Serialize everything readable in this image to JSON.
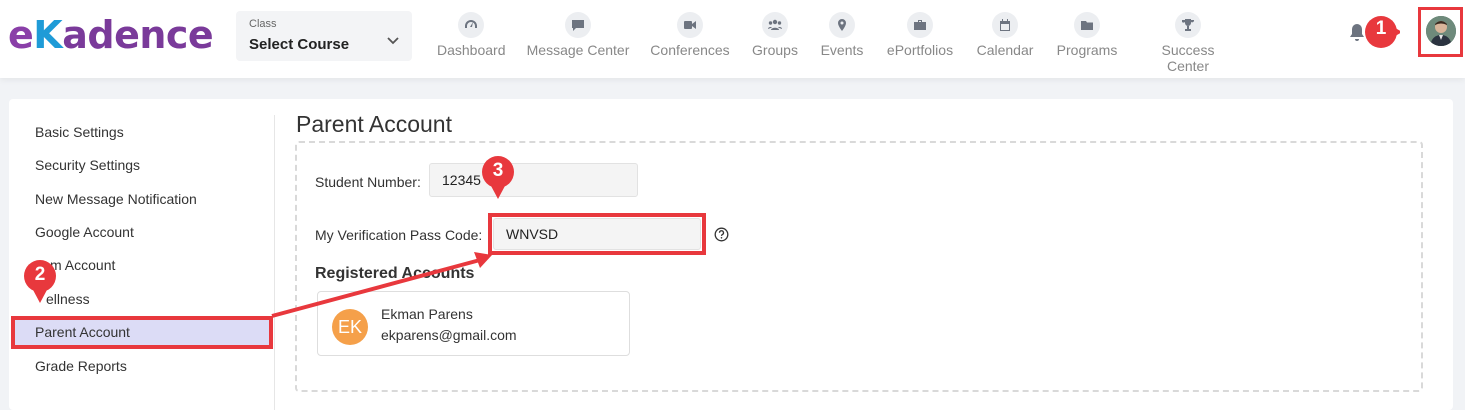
{
  "brand": {
    "e": "e",
    "k": "K",
    "rest": "adence"
  },
  "class_select": {
    "label": "Class",
    "value": "Select Course"
  },
  "nav": [
    {
      "label": "Dashboard",
      "icon": "gauge-icon"
    },
    {
      "label": "Message Center",
      "icon": "chat-icon"
    },
    {
      "label": "Conferences",
      "icon": "video-icon"
    },
    {
      "label": "Groups",
      "icon": "users-icon"
    },
    {
      "label": "Events",
      "icon": "map-pin-icon"
    },
    {
      "label": "ePortfolios",
      "icon": "briefcase-icon"
    },
    {
      "label": "Calendar",
      "icon": "calendar-icon"
    },
    {
      "label": "Programs",
      "icon": "folder-icon"
    },
    {
      "label": "Success Center",
      "icon": "trophy-icon"
    }
  ],
  "markers": [
    "1",
    "2",
    "3"
  ],
  "sidebar": {
    "items": [
      {
        "label": "Basic Settings"
      },
      {
        "label": "Security Settings"
      },
      {
        "label": "New Message Notification"
      },
      {
        "label": "Google Account"
      },
      {
        "label": "m Account"
      },
      {
        "label": "ellness"
      },
      {
        "label": "Parent Account",
        "active": true
      },
      {
        "label": "Grade Reports"
      }
    ]
  },
  "main": {
    "title": "Parent Account",
    "student_number_label": "Student Number:",
    "student_number_value": "12345",
    "pass_code_label": "My Verification Pass Code:",
    "pass_code_value": "WNVSD",
    "registered_title": "Registered Accounts",
    "registered": [
      {
        "initials": "EK",
        "name": "Ekman Parens",
        "email": "ekparens@gmail.com"
      }
    ]
  },
  "colors": {
    "accent_red": "#e8383d",
    "brand_purple": "#7a3a9a",
    "brand_blue": "#1f9bd7",
    "avatar_orange": "#f5a04a",
    "active_bg": "#dcdcf6"
  }
}
